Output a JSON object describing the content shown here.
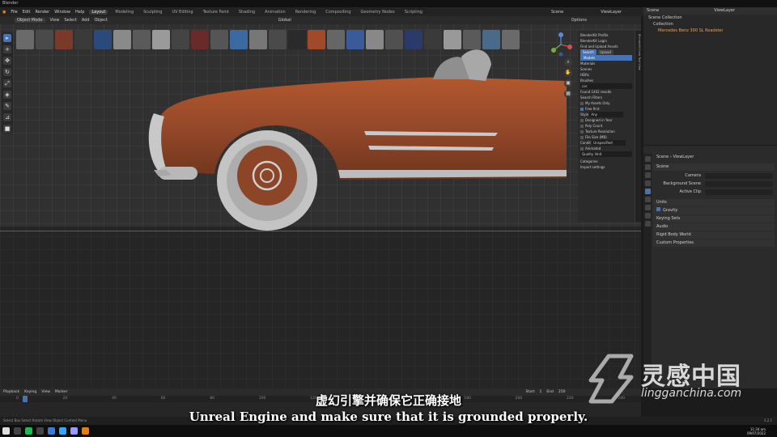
{
  "app": {
    "title": "Blender"
  },
  "menu": {
    "items": [
      "File",
      "Edit",
      "Render",
      "Window",
      "Help"
    ]
  },
  "workspaces": {
    "tabs": [
      "Layout",
      "Modeling",
      "Sculpting",
      "UV Editing",
      "Texture Paint",
      "Shading",
      "Animation",
      "Rendering",
      "Compositing",
      "Geometry Nodes",
      "Scripting"
    ],
    "active": "Layout"
  },
  "scene_selector": {
    "scene": "Scene",
    "view_layer": "ViewLayer"
  },
  "viewport_header": {
    "mode": "Object Mode",
    "menus": [
      "View",
      "Select",
      "Add",
      "Object"
    ],
    "transform": "Global",
    "options_label": "Options"
  },
  "n_panel": {
    "blenderkit_profile": "BlenderKit Profile",
    "login": "BlenderKit Login",
    "find_upload": "Find and Upload Assets",
    "search_tab": "Search",
    "upload_tab": "Upload",
    "asset_types": [
      "Models",
      "Materials",
      "Scenes",
      "HDRs",
      "Brushes"
    ],
    "active_type": "Models",
    "search_value": "car",
    "found": "Found 1402 results",
    "search_filters": "Search Filters",
    "my_assets": "My Assets Only",
    "free_first": "Free first",
    "style_label": "Style",
    "style_value": "Any",
    "designed_in_year": "Designed in Year",
    "poly_count": "Poly Count",
    "texture_resolution": "Texture Resolution",
    "file_size": "File Size (MB)",
    "condition_label": "Condit",
    "condition_value": "Unspecified",
    "animated": "Animated",
    "quality_limit": "Quality limit",
    "categories": "Categories",
    "import_settings": "Import settings",
    "side_tabs": "BlenderKit   Item   Tool   View"
  },
  "outliner": {
    "title": "Scene",
    "view_layer": "ViewLayer",
    "rows": [
      "Scene Collection",
      "Collection",
      "Mercedes Benz 300 SL Roadster"
    ]
  },
  "properties": {
    "breadcrumb_scene": "Scene",
    "breadcrumb_layer": "ViewLayer",
    "scene_section": "Scene",
    "camera_label": "Camera",
    "background_label": "Background Scene",
    "active_clip_label": "Active Clip",
    "sections": [
      "Units",
      "Gravity",
      "Keying Sets",
      "Audio",
      "Rigid Body World",
      "Custom Properties"
    ],
    "gravity_checked": true
  },
  "timeline": {
    "menus": [
      "Playback",
      "Keying",
      "View",
      "Marker"
    ],
    "current_frame": "1",
    "ruler": [
      "0",
      "20",
      "40",
      "60",
      "80",
      "100",
      "120",
      "140",
      "160",
      "180",
      "200",
      "220",
      "240"
    ],
    "start_label": "Start",
    "start": "1",
    "end_label": "End",
    "end": "250"
  },
  "statusbar": {
    "left": "Select     Box Select     Rotate View     Object Context Menu",
    "right": "3.2.1"
  },
  "taskbar": {
    "time": "11:34 am",
    "date": "09/07/2022"
  },
  "subtitles": {
    "zh": "虚幻引擎并确保它正确接地",
    "en": "Unreal Engine and make sure that it is grounded properly."
  },
  "watermark": {
    "cn": "灵感中国",
    "url": "lingganchina.com"
  },
  "colors": {
    "accent": "#4772b3",
    "car_body": "#9a4a26",
    "background": "#303030"
  }
}
